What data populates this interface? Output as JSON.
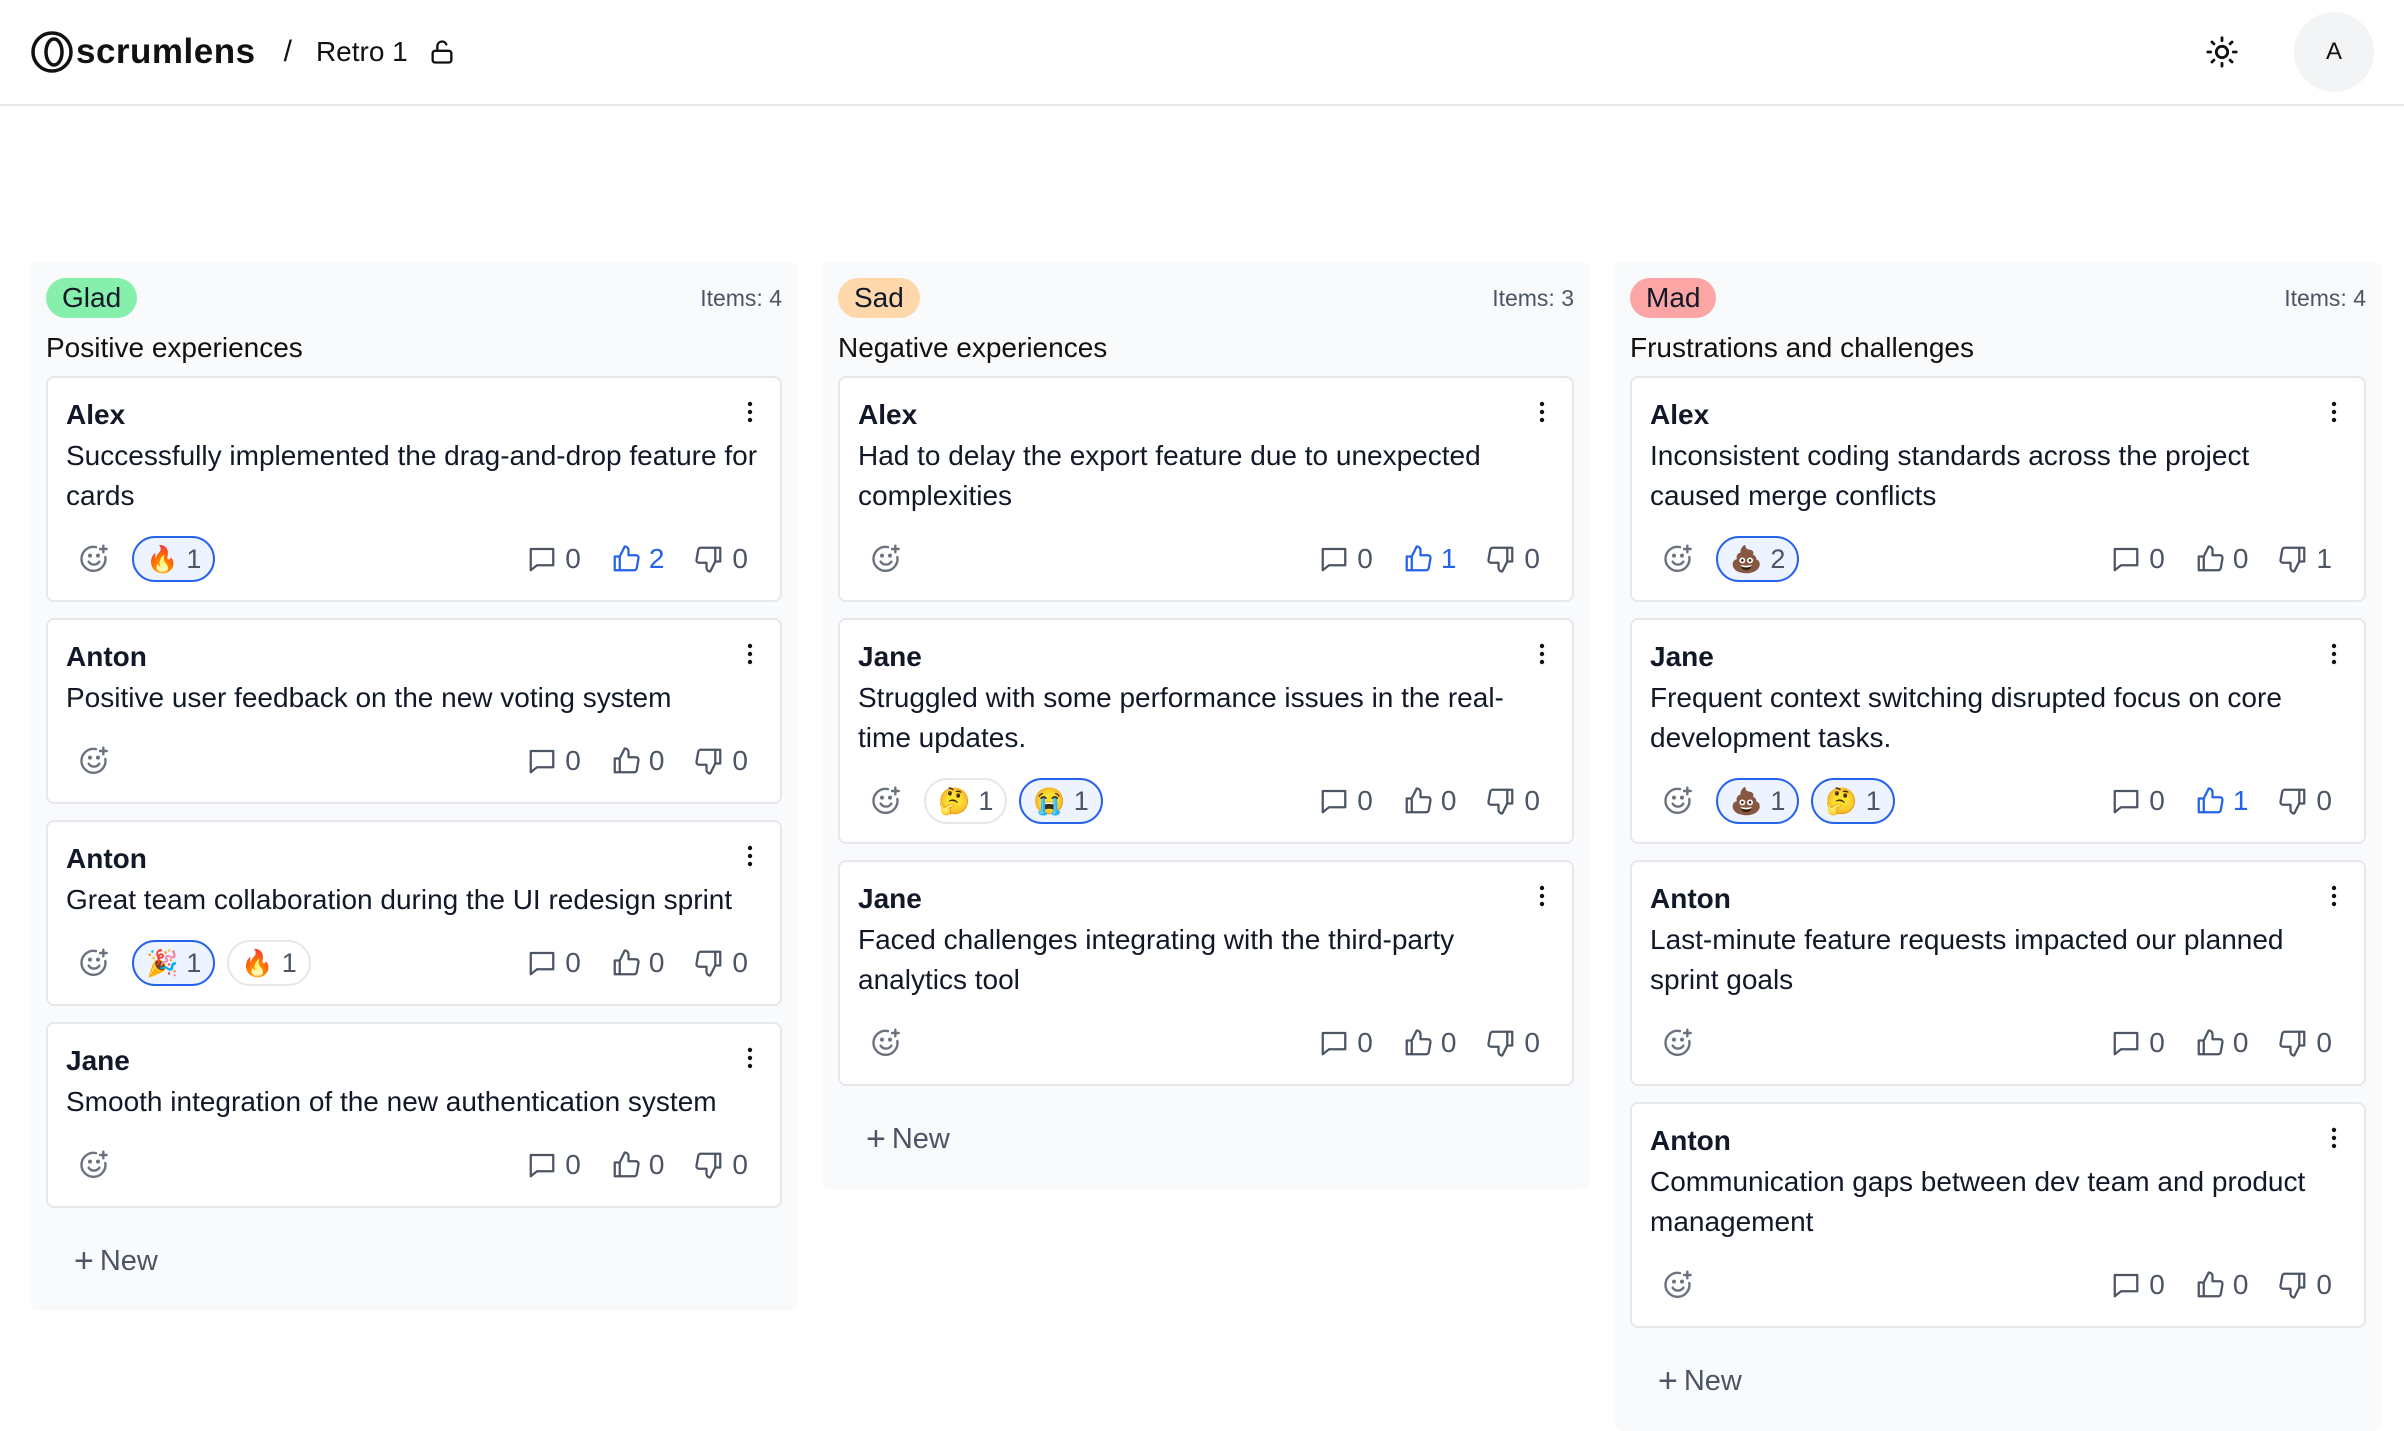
{
  "header": {
    "brand": "scrumlens",
    "separator": "/",
    "board_title": "Retro 1",
    "avatar_initial": "A"
  },
  "colors": {
    "glad": "#86efac",
    "sad": "#fed7aa",
    "mad": "#fca5a5",
    "accent": "#2563eb"
  },
  "columns": [
    {
      "tag": "Glad",
      "items_label": "Items: 4",
      "description": "Positive experiences",
      "new_label": "New",
      "cards": [
        {
          "author": "Alex",
          "text": "Successfully implemented the drag-and-drop feature for cards",
          "reactions": [
            {
              "emoji": "🔥",
              "count": "1",
              "mine": true
            }
          ],
          "comments": "0",
          "likes": "2",
          "likes_active": true,
          "dislikes": "0",
          "dislikes_active": false
        },
        {
          "author": "Anton",
          "text": "Positive user feedback on the new voting system",
          "reactions": [],
          "comments": "0",
          "likes": "0",
          "likes_active": false,
          "dislikes": "0",
          "dislikes_active": false
        },
        {
          "author": "Anton",
          "text": "Great team collaboration during the UI redesign sprint",
          "reactions": [
            {
              "emoji": "🎉",
              "count": "1",
              "mine": true
            },
            {
              "emoji": "🔥",
              "count": "1",
              "mine": false
            }
          ],
          "comments": "0",
          "likes": "0",
          "likes_active": false,
          "dislikes": "0",
          "dislikes_active": false
        },
        {
          "author": "Jane",
          "text": "Smooth integration of the new authentication system",
          "reactions": [],
          "comments": "0",
          "likes": "0",
          "likes_active": false,
          "dislikes": "0",
          "dislikes_active": false
        }
      ]
    },
    {
      "tag": "Sad",
      "items_label": "Items: 3",
      "description": "Negative experiences",
      "new_label": "New",
      "cards": [
        {
          "author": "Alex",
          "text": "Had to delay the export feature due to unexpected complexities",
          "reactions": [],
          "comments": "0",
          "likes": "1",
          "likes_active": true,
          "dislikes": "0",
          "dislikes_active": false
        },
        {
          "author": "Jane",
          "text": "Struggled with some performance issues in the real-time updates.",
          "reactions": [
            {
              "emoji": "🤔",
              "count": "1",
              "mine": false
            },
            {
              "emoji": "😭",
              "count": "1",
              "mine": true
            }
          ],
          "comments": "0",
          "likes": "0",
          "likes_active": false,
          "dislikes": "0",
          "dislikes_active": false
        },
        {
          "author": "Jane",
          "text": "Faced challenges integrating with the third-party analytics tool",
          "reactions": [],
          "comments": "0",
          "likes": "0",
          "likes_active": false,
          "dislikes": "0",
          "dislikes_active": false
        }
      ]
    },
    {
      "tag": "Mad",
      "items_label": "Items: 4",
      "description": "Frustrations and challenges",
      "new_label": "New",
      "cards": [
        {
          "author": "Alex",
          "text": "Inconsistent coding standards across the project caused merge conflicts",
          "reactions": [
            {
              "emoji": "💩",
              "count": "2",
              "mine": true
            }
          ],
          "comments": "0",
          "likes": "0",
          "likes_active": false,
          "dislikes": "1",
          "dislikes_active": false
        },
        {
          "author": "Jane",
          "text": "Frequent context switching disrupted focus on core development tasks.",
          "reactions": [
            {
              "emoji": "💩",
              "count": "1",
              "mine": true
            },
            {
              "emoji": "🤔",
              "count": "1",
              "mine": true
            }
          ],
          "comments": "0",
          "likes": "1",
          "likes_active": true,
          "dislikes": "0",
          "dislikes_active": false
        },
        {
          "author": "Anton",
          "text": "Last-minute feature requests impacted our planned sprint goals",
          "reactions": [],
          "comments": "0",
          "likes": "0",
          "likes_active": false,
          "dislikes": "0",
          "dislikes_active": false
        },
        {
          "author": "Anton",
          "text": "Communication gaps between dev team and product management",
          "reactions": [],
          "comments": "0",
          "likes": "0",
          "likes_active": false,
          "dislikes": "0",
          "dislikes_active": false
        }
      ]
    }
  ]
}
